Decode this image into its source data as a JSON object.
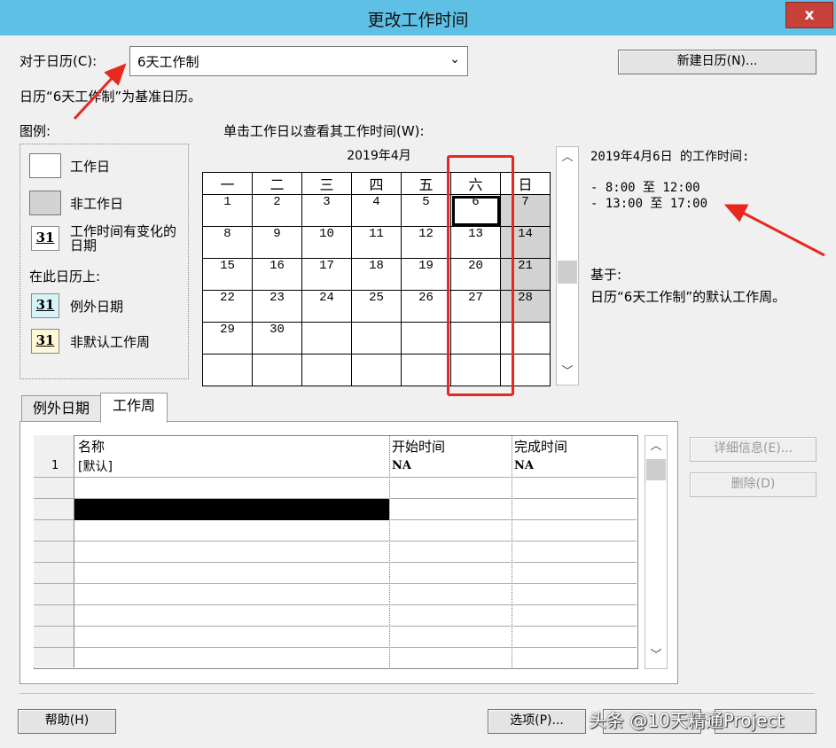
{
  "window": {
    "title": "更改工作时间",
    "close_label": "x"
  },
  "calendar_select": {
    "label": "对于日历(C):",
    "value": "6天工作制"
  },
  "new_calendar_button": "新建日历(N)...",
  "base_calendar_text": "日历“6天工作制”为基准日历。",
  "legend": {
    "title": "图例:",
    "items": [
      "工作日",
      "非工作日",
      "工作时间有变化的日期"
    ],
    "section_label": "在此日历上:",
    "on_calendar": [
      "例外日期",
      "非默认工作周"
    ],
    "badge_text": "31"
  },
  "calendar": {
    "prompt": "单击工作日以查看其工作时间(W):",
    "month": "2019年4月",
    "weekdays": [
      "一",
      "二",
      "三",
      "四",
      "五",
      "六",
      "日"
    ],
    "weeks": [
      [
        "1",
        "2",
        "3",
        "4",
        "5",
        "6",
        "7"
      ],
      [
        "8",
        "9",
        "10",
        "11",
        "12",
        "13",
        "14"
      ],
      [
        "15",
        "16",
        "17",
        "18",
        "19",
        "20",
        "21"
      ],
      [
        "22",
        "23",
        "24",
        "25",
        "26",
        "27",
        "28"
      ],
      [
        "29",
        "30",
        "",
        "",
        "",
        "",
        ""
      ],
      [
        "",
        "",
        "",
        "",
        "",
        "",
        ""
      ]
    ]
  },
  "working_times": {
    "header": "2019年4月6日 的工作时间:",
    "lines": [
      "- 8:00 至 12:00",
      "- 13:00 至 17:00"
    ],
    "based_on_label": "基于:",
    "based_on_text": "日历“6天工作制”的默认工作周。"
  },
  "tabs": [
    "例外日期",
    "工作周"
  ],
  "grid": {
    "columns": [
      "名称",
      "开始时间",
      "完成时间"
    ],
    "rows": [
      {
        "num": "1",
        "name": "[默认]",
        "start": "NA",
        "finish": "NA"
      }
    ]
  },
  "side_buttons": {
    "details": "详细信息(E)...",
    "delete": "删除(D)"
  },
  "bottom_buttons": {
    "help": "帮助(H)",
    "options": "选项(P)..."
  },
  "watermark": "头条 @10天精通Project",
  "colors": {
    "titlebar": "#5fc0e6",
    "close": "#c7403a",
    "annotation": "#e8281e"
  }
}
